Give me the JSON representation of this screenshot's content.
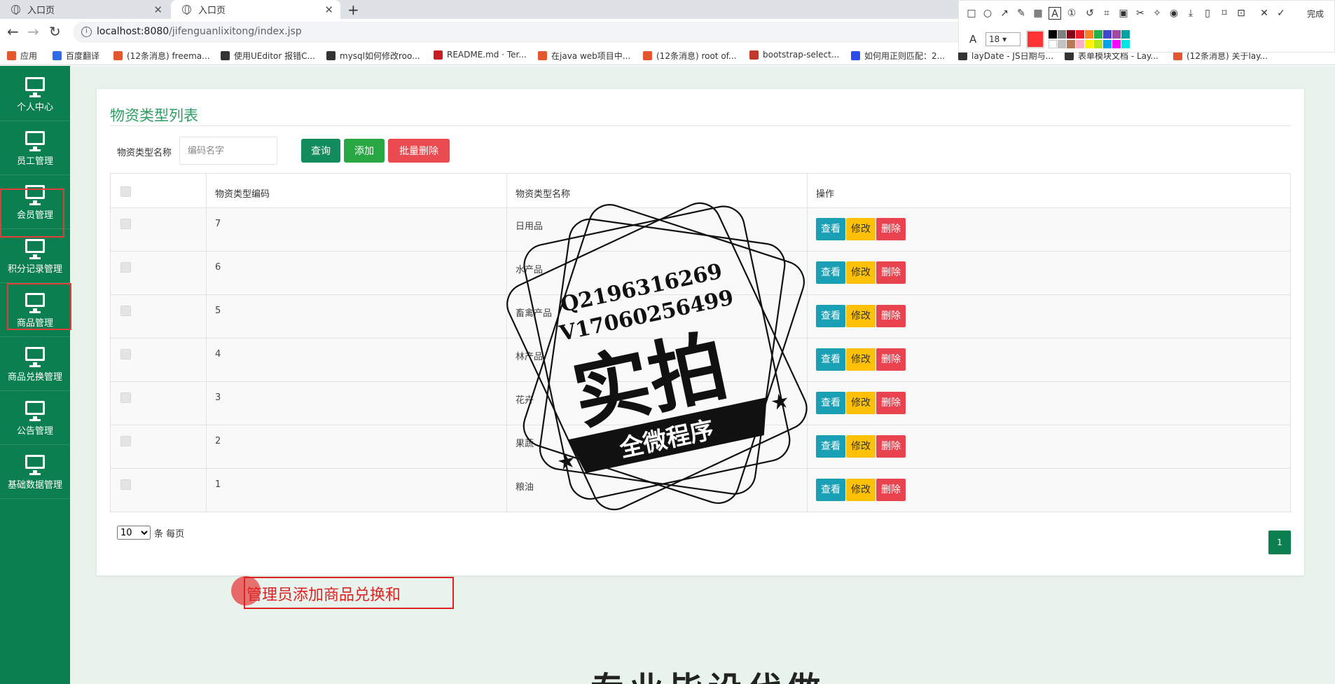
{
  "browser": {
    "tabs": [
      {
        "label": "入口页",
        "active": false
      },
      {
        "label": "入口页",
        "active": true
      }
    ],
    "url_host": "localhost:8080",
    "url_path": "/jifenguanlixitong/index.jsp",
    "bookmarks": [
      {
        "label": "应用",
        "icon": "apps-grid-icon",
        "color": "#e4572e"
      },
      {
        "label": "百度翻译",
        "icon": "translate-icon",
        "color": "#2b6de9"
      },
      {
        "label": "(12条消息) freema...",
        "icon": "csdn-icon",
        "color": "#e4572e"
      },
      {
        "label": "使用UEditor 报错C...",
        "icon": "segment-icon",
        "color": "#333333"
      },
      {
        "label": "mysql如何修改roo...",
        "icon": "segment-icon",
        "color": "#333333"
      },
      {
        "label": "README.md · Ter...",
        "icon": "gitee-icon",
        "color": "#c71d23"
      },
      {
        "label": "在java web项目中...",
        "icon": "csdn-icon",
        "color": "#e4572e"
      },
      {
        "label": "(12条消息) root of...",
        "icon": "csdn-icon",
        "color": "#e4572e"
      },
      {
        "label": "bootstrap-select...",
        "icon": "juejin-icon",
        "color": "#c0392b"
      },
      {
        "label": "如何用正则匹配：2...",
        "icon": "baidu-paw-icon",
        "color": "#2b4ee9"
      },
      {
        "label": "layDate - JS日期与...",
        "icon": "layui-icon",
        "color": "#333333"
      },
      {
        "label": "表单模块文档 - Lay...",
        "icon": "layui-icon",
        "color": "#333333"
      },
      {
        "label": "(12条消息) 关于lay...",
        "icon": "csdn-icon",
        "color": "#e4572e"
      }
    ]
  },
  "snip_toolbar": {
    "font_size": "18",
    "done_label": "完成",
    "current_color": "#ff3333"
  },
  "sidebar": {
    "items": [
      {
        "label": "个人中心",
        "highlighted": false
      },
      {
        "label": "员工管理",
        "highlighted": false
      },
      {
        "label": "会员管理",
        "highlighted": false
      },
      {
        "label": "积分记录管理",
        "highlighted": true
      },
      {
        "label": "商品管理",
        "highlighted": false
      },
      {
        "label": "商品兑换管理",
        "highlighted": true
      },
      {
        "label": "公告管理",
        "highlighted": false
      },
      {
        "label": "基础数据管理",
        "highlighted": false
      }
    ]
  },
  "main": {
    "title": "物资类型列表",
    "search_label": "物资类型名称",
    "search_placeholder": "编码名字",
    "query_button": "查询",
    "add_button": "添加",
    "batch_delete_button": "批量删除",
    "columns": [
      "物资类型编码",
      "物资类型名称",
      "操作"
    ],
    "rows": [
      {
        "code": "7",
        "name": "日用品"
      },
      {
        "code": "6",
        "name": "水产品"
      },
      {
        "code": "5",
        "name": "畜禽产品"
      },
      {
        "code": "4",
        "name": "林产品"
      },
      {
        "code": "3",
        "name": "花卉"
      },
      {
        "code": "2",
        "name": "果蔬"
      },
      {
        "code": "1",
        "name": "粮油"
      }
    ],
    "row_actions": {
      "view": "查看",
      "edit": "修改",
      "delete": "删除"
    },
    "page_size": "10",
    "page_size_suffix": "条 每页",
    "current_page": "1"
  },
  "annotation_text": "管理员添加商品兑换和",
  "bottom_heading": "专业毕设代做",
  "watermark": {
    "line1": "Q2196316269",
    "line2": "V17060256499",
    "big": "实拍",
    "ribbon": "全微程序"
  },
  "colors": {
    "sidebar": "#0b7f4f",
    "title": "#2f9e64",
    "view": "#1aa0b5",
    "edit": "#ffc107",
    "delete": "#e9434f"
  }
}
